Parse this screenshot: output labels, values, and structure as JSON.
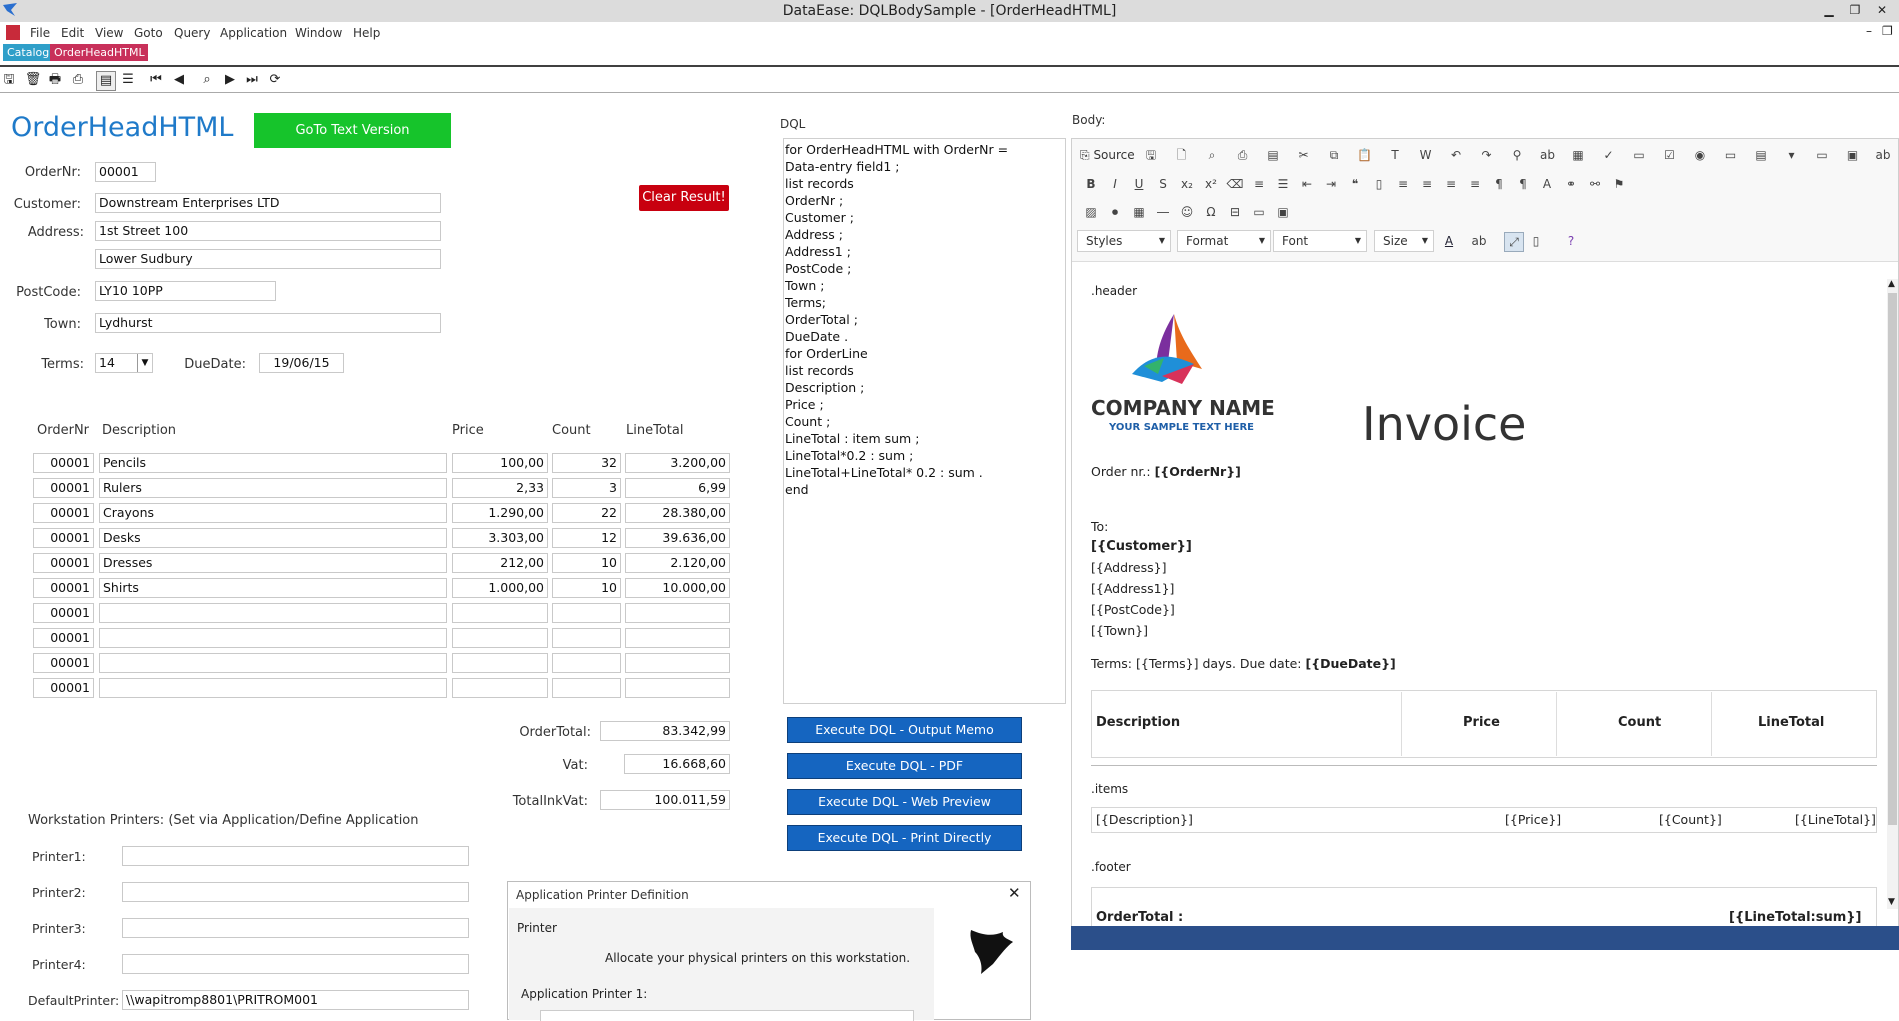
{
  "app": {
    "title": "DataEase: DQLBodySample - [OrderHeadHTML]"
  },
  "menu": [
    "File",
    "Edit",
    "View",
    "Goto",
    "Query",
    "Application",
    "Window",
    "Help"
  ],
  "tabs": [
    {
      "label": "Catalog",
      "color": "#2f9fc9"
    },
    {
      "label": "OrderHeadHTML",
      "color": "#c8305a"
    }
  ],
  "form": {
    "title": "OrderHeadHTML",
    "goto_text_button": "GoTo Text Version",
    "clear_button": "Clear Result!",
    "ordernr_label": "OrderNr:",
    "ordernr": "00001",
    "customer_label": "Customer:",
    "customer": "Downstream Enterprises LTD",
    "address_label": "Address:",
    "address": "1st Street 100",
    "address1": "Lower Sudbury",
    "postcode_label": "PostCode:",
    "postcode": "LY10 10PP",
    "town_label": "Town:",
    "town": "Lydhurst",
    "terms_label": "Terms:",
    "terms": "14",
    "duedate_label": "DueDate:",
    "duedate": "19/06/15"
  },
  "lines": {
    "headers": [
      "OrderNr",
      "Description",
      "Price",
      "Count",
      "LineTotal"
    ],
    "rows": [
      [
        "00001",
        "Pencils",
        "100,00",
        "32",
        "3.200,00"
      ],
      [
        "00001",
        "Rulers",
        "2,33",
        "3",
        "6,99"
      ],
      [
        "00001",
        "Crayons",
        "1.290,00",
        "22",
        "28.380,00"
      ],
      [
        "00001",
        "Desks",
        "3.303,00",
        "12",
        "39.636,00"
      ],
      [
        "00001",
        "Dresses",
        "212,00",
        "10",
        "2.120,00"
      ],
      [
        "00001",
        "Shirts",
        "1.000,00",
        "10",
        "10.000,00"
      ],
      [
        "00001",
        "",
        "",
        "",
        ""
      ],
      [
        "00001",
        "",
        "",
        "",
        ""
      ],
      [
        "00001",
        "",
        "",
        "",
        ""
      ],
      [
        "00001",
        "",
        "",
        "",
        ""
      ]
    ]
  },
  "totals": {
    "ordertotal_label": "OrderTotal:",
    "ordertotal": "83.342,99",
    "vat_label": "Vat:",
    "vat": "16.668,60",
    "totalinkvat_label": "TotalInkVat:",
    "totalinkvat": "100.011,59"
  },
  "printers": {
    "heading": "Workstation Printers: (Set via Application/Define Application",
    "labels": [
      "Printer1:",
      "Printer2:",
      "Printer3:",
      "Printer4:",
      "DefaultPrinter:"
    ],
    "values": [
      "",
      "",
      "",
      "",
      "\\\\wapitromp8801\\PRITROM001"
    ]
  },
  "dql": {
    "label": "DQL",
    "lines": [
      "for OrderHeadHTML with OrderNr =",
      "Data-entry field1 ;",
      "list records",
      "OrderNr ;",
      "Customer ;",
      "Address ;",
      "Address1 ;",
      "PostCode ;",
      "Town ;",
      "Terms;",
      "OrderTotal ;",
      "DueDate .",
      "for OrderLine",
      "list records",
      "Description ;",
      "Price ;",
      "Count ;",
      "LineTotal : item sum ;",
      "LineTotal*0.2 : sum ;",
      "LineTotal+LineTotal* 0.2 : sum .",
      "end"
    ],
    "buttons": [
      "Execute DQL - Output Memo",
      "Execute DQL - PDF",
      "Execute DQL - Web Preview",
      "Execute DQL - Print Directly"
    ]
  },
  "body": {
    "label": "Body:",
    "source": "Source",
    "combos": [
      "Styles",
      "Format",
      "Font",
      "Size"
    ],
    "header_tag": ".header",
    "company": "COMPANY NAME",
    "company_sub": "YOUR SAMPLE TEXT HERE",
    "invoice": "Invoice",
    "order_prefix": "Order nr.: ",
    "order_field": "[{OrderNr}]",
    "to": "To:",
    "customer": "[{Customer}]",
    "address_lines": [
      "[{Address}]",
      "[{Address1}]",
      "[{PostCode}]",
      "[{Town}]"
    ],
    "terms_prefix": "Terms: [{Terms}] days. Due date: ",
    "terms_due": "[{DueDate}]",
    "table_headers": [
      "Description",
      "Price",
      "Count",
      "LineTotal"
    ],
    "items_tag": ".items",
    "item_row": [
      "[{Description}]",
      "[{Price}]",
      "[{Count}]",
      "[{LineTotal}]"
    ],
    "footer_tag": ".footer",
    "footer_left": "OrderTotal :",
    "footer_right": "[{LineTotal:sum}]"
  },
  "dialog": {
    "title": "Application Printer Definition",
    "section": "Printer",
    "text": "Allocate your physical printers on this workstation.",
    "field_label": "Application Printer 1:"
  },
  "colors": {
    "green": "#16c42b",
    "red": "#c8000f",
    "blue": "#1565c0",
    "title_blue": "#1f7ac9",
    "editor_bar": "#2b4f8a"
  }
}
